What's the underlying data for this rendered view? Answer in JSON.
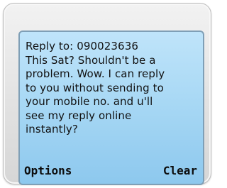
{
  "message": {
    "lines": [
      "Reply to: 090023636",
      "This Sat? Shouldn't be a",
      "problem. Wow. I can reply",
      "to you without sending to",
      "your mobile no. and u'll",
      "see my reply online",
      "instantly?"
    ]
  },
  "softkeys": {
    "left_label": "Options",
    "right_label": "Clear"
  }
}
